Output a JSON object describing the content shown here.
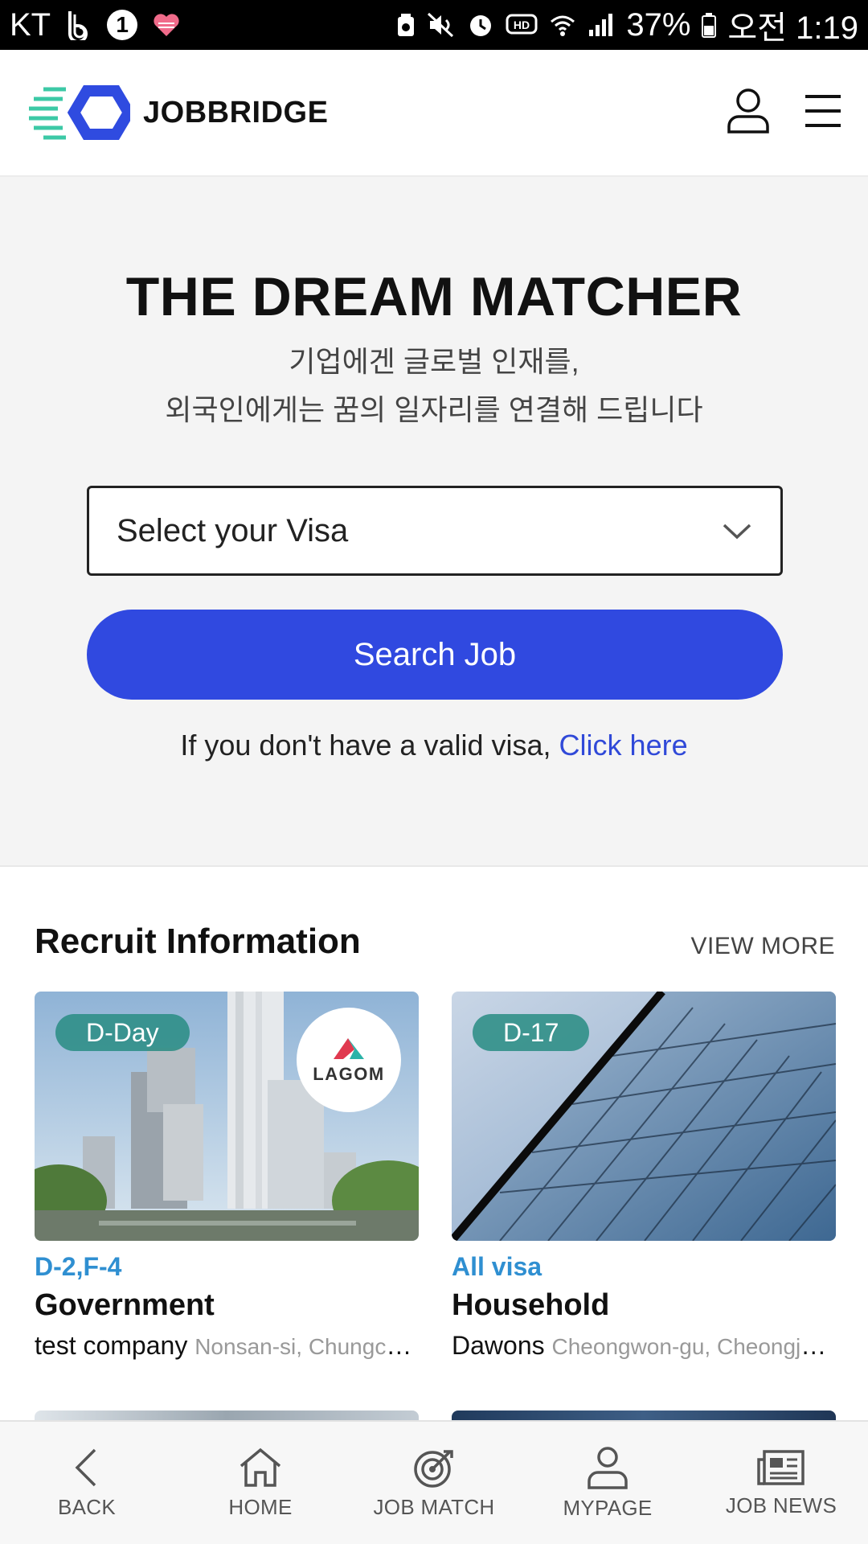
{
  "status_bar": {
    "carrier": "KT",
    "notif_count": "1",
    "battery": "37%",
    "time": "오전 1:19",
    "icons": [
      "b-app-icon",
      "heart-icon",
      "storage-icon",
      "mute-icon",
      "alarm-icon",
      "hd-icon",
      "wifi-icon",
      "signal-icon",
      "battery-icon"
    ]
  },
  "header": {
    "logo_text": "JOBBRIDGE",
    "icons": [
      "user-icon",
      "hamburger-menu-icon"
    ]
  },
  "hero": {
    "title": "THE DREAM MATCHER",
    "subtitle_line1": "기업에겐 글로벌 인재를,",
    "subtitle_line2": "외국인에게는 꿈의 일자리를 연결해 드립니다",
    "visa_select_label": "Select your Visa",
    "search_button": "Search Job",
    "visa_note": "If you don't have a valid visa,",
    "visa_note_link": "Click here"
  },
  "recruit": {
    "title": "Recruit Information",
    "view_more": "VIEW MORE",
    "cards": [
      {
        "dday": "D-Day",
        "logo_text": "LAGOM",
        "visa": "D-2,F-4",
        "title": "Government",
        "company": "test company",
        "location": "Nonsan-si, Chungcheongnam-do"
      },
      {
        "dday": "D-17",
        "visa": "All visa",
        "title": "Household",
        "company": "Dawons",
        "location": "Cheongwon-gu, Cheongju-si"
      }
    ]
  },
  "bottom_nav": {
    "items": [
      {
        "label": "BACK",
        "icon": "back-chevron-icon"
      },
      {
        "label": "HOME",
        "icon": "home-icon"
      },
      {
        "label": "JOB MATCH",
        "icon": "target-icon"
      },
      {
        "label": "MYPAGE",
        "icon": "user-icon"
      },
      {
        "label": "JOB NEWS",
        "icon": "newspaper-icon"
      }
    ]
  },
  "colors": {
    "accent_blue": "#3049e0",
    "link_blue": "#3049d8",
    "visa_blue": "#2f8fd1",
    "dday_teal": "#288c82",
    "logo_teal": "#3cc9a6",
    "logo_blue": "#2f4be0"
  }
}
